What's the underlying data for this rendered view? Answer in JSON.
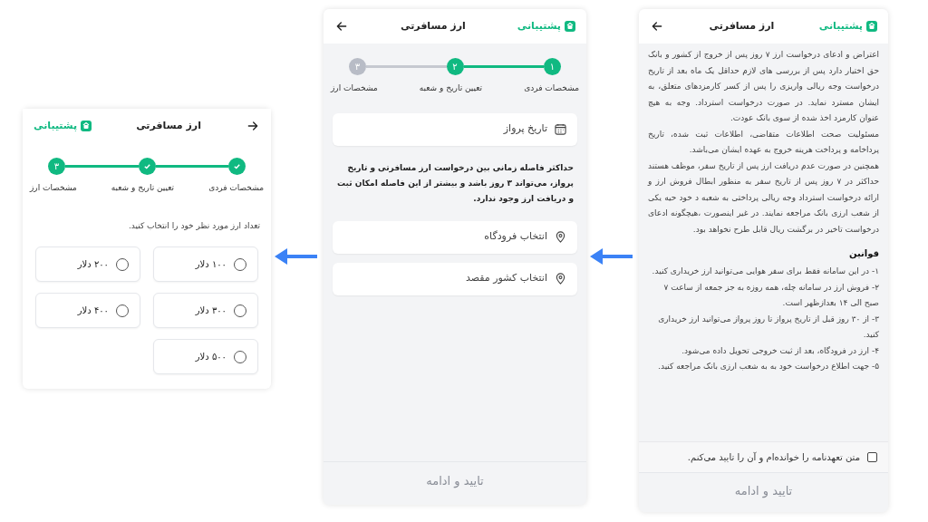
{
  "amount_screen": {
    "header": {
      "title": "ارز مسافرتی",
      "support": "پشتیبانی"
    },
    "steps": [
      {
        "label": "مشخصات فردی",
        "done": true,
        "active": true
      },
      {
        "label": "تعیین تاریخ و شعبه",
        "done": true,
        "active": true
      },
      {
        "number": "۳",
        "label": "مشخصات ارز",
        "done": false,
        "active": true
      }
    ],
    "prompt": "تعداد ارز مورد نظر خود را انتخاب کنید.",
    "options": [
      {
        "label": "۱۰۰ دلار",
        "selected": false
      },
      {
        "label": "۲۰۰ دلار",
        "selected": false
      },
      {
        "label": "۳۰۰ دلار",
        "selected": false
      },
      {
        "label": "۴۰۰ دلار",
        "selected": false
      },
      {
        "label": "۵۰۰ دلار",
        "selected": false
      }
    ]
  },
  "flight_screen": {
    "header": {
      "title": "ارز مسافرتی",
      "support": "پشتیبانی"
    },
    "steps": [
      {
        "number": "۱",
        "label": "مشخصات فردی",
        "done": false,
        "active": true
      },
      {
        "number": "۲",
        "label": "تعیین تاریخ و شعبه",
        "done": false,
        "active": true
      },
      {
        "number": "۳",
        "label": "مشخصات ارز",
        "done": false,
        "active": false
      }
    ],
    "date_field": {
      "placeholder": "تاریخ پرواز"
    },
    "note": "حداکثر فاصله زمانی بین درخواست ارز مسافرتی و تاریخ پرواز، می‌تواند ۳ روز باشد و بیشتر از این فاصله امکان ثبت و دریافت ارز وجود ندارد.",
    "selects": [
      {
        "placeholder": "انتخاب فرودگاه"
      },
      {
        "placeholder": "انتخاب کشور مقصد"
      }
    ],
    "button": {
      "label": "تایید و ادامه",
      "disabled": true
    }
  },
  "terms_screen": {
    "header": {
      "title": "ارز مسافرتی",
      "support": "پشتیبانی"
    },
    "paragraphs": [
      "اعتراض و ادعای درخواست ارز ۷ روز پس از خروج از کشور و بانک حق اختیار دارد پس از بررسی های لازم حداقل یک ماه بعد از تاریخ درخواست وجه ریالی واریزی را پس از کسر کارمزدهای متعلق، به ایشان مسترد نماید. در صورت درخواست استرداد. وجه به هیچ عنوان کارمزد اخذ شده از سوی بانک عودت.",
      "مسئولیت صحت اطلاعات متقاضی، اطلاعات ثبت شده، تاریخ پرداخامه و پرداخت هرینه خروج به عهده ایشان می‌باشد.",
      "همچنین در صورت عدم دریافت ارز پس از تاریخ سفر، موظف هستند حداکثر در ۷ روز پس از تاریخ سفر به منظور ابطال فروش ارز و ارائه درخواست استرداد وجه ریالی پرداختی به شعبه د خود حیه یکی از شعب ارزی بانک مراجعه نمایند. در غیر اینصورت ،هیچگونه ادعای درخواست تاخیر در برگشت ریال قابل طرح نخواهد بود."
    ],
    "rules_title": "قوانین",
    "rules": [
      "۱- در این سامانه فقط برای سفر هوایی می‌توانید ارز خریداری کنید.",
      "۲- فروش ارز در سامانه چله، همه روزه به جز جمعه از ساعت ۷ صبح الی ۱۴ بعدازظهر است.",
      "۳- از ۳۰ روز قبل از تاریخ پرواز تا روز پرواز می‌توانید ارز خریداری کنید.",
      "۴- ارز در فرودگاه، بعد از ثبت خروجی تحویل داده می‌شود.",
      "۵- جهت اطلاع درخواست خود به به شعب ارزی بانک مراجعه کنید."
    ],
    "agreement": {
      "label": "متن تعهدنامه را خوانده‌ام و آن را تایید می‌کنم.",
      "checked": false
    },
    "button": {
      "label": "تایید و ادامه",
      "disabled": true
    }
  }
}
